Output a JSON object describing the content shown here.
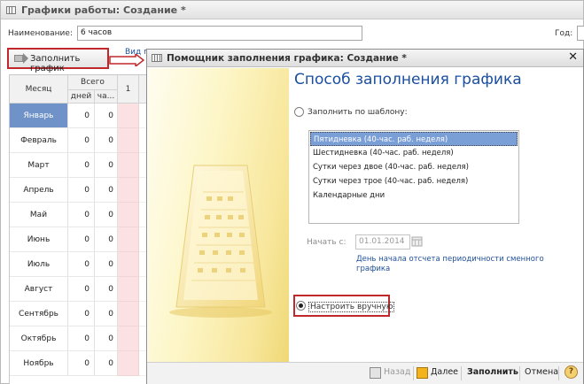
{
  "main_window": {
    "title": "Графики работы: Создание *",
    "name_label": "Наименование:",
    "name_value": "6 часов",
    "year_label": "Год:",
    "fill_button_label": "Заполнить график",
    "view_label": "Вид г"
  },
  "table": {
    "headers": {
      "month": "Месяц",
      "total": "Всего",
      "days": "дней",
      "hours": "ча...",
      "col1": "1"
    },
    "rows": [
      {
        "month": "Январь",
        "days": "0",
        "hours": "0"
      },
      {
        "month": "Февраль",
        "days": "0",
        "hours": "0"
      },
      {
        "month": "Март",
        "days": "0",
        "hours": "0"
      },
      {
        "month": "Апрель",
        "days": "0",
        "hours": "0"
      },
      {
        "month": "Май",
        "days": "0",
        "hours": "0"
      },
      {
        "month": "Июнь",
        "days": "0",
        "hours": "0"
      },
      {
        "month": "Июль",
        "days": "0",
        "hours": "0"
      },
      {
        "month": "Август",
        "days": "0",
        "hours": "0"
      },
      {
        "month": "Сентябрь",
        "days": "0",
        "hours": "0"
      },
      {
        "month": "Октябрь",
        "days": "0",
        "hours": "0"
      },
      {
        "month": "Ноябрь",
        "days": "0",
        "hours": "0"
      }
    ],
    "selected_month": "Январь"
  },
  "dialog": {
    "title": "Помощник заполнения графика: Создание *",
    "close_symbol": "✕",
    "heading": "Способ заполнения графика",
    "option_template": "Заполнить по шаблону:",
    "templates": [
      "Пятидневка (40-час. раб. неделя)",
      "Шестидневка (40-час. раб. неделя)",
      "Сутки через двое (40-час. раб. неделя)",
      "Сутки через трое (40-час. раб. неделя)",
      "Календарные дни"
    ],
    "selected_template": "Пятидневка (40-час. раб. неделя)",
    "start_label": "Начать с:",
    "start_date": "01.01.2014",
    "hint": "День начала отсчета периодичности сменного графика",
    "option_manual": "Настроить вручную",
    "selected_option": "manual",
    "buttons": {
      "back": "Назад",
      "next": "Далее",
      "fill": "Заполнить",
      "cancel": "Отмена",
      "help": "?"
    }
  },
  "colors": {
    "accent_blue": "#1a4fa0",
    "highlight_red": "#c0282c",
    "selection": "#7a9fd6",
    "table_pink": "#fbe1e1"
  }
}
